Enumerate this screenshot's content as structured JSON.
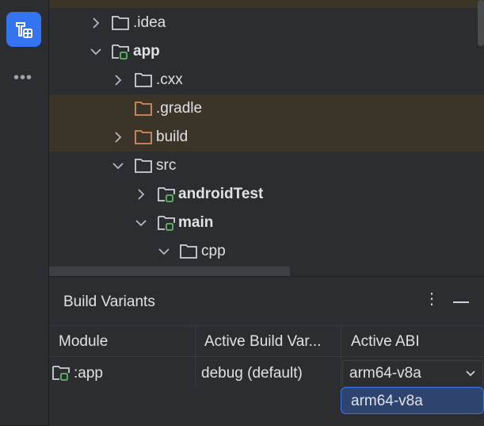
{
  "tree": {
    "items": [
      {
        "label": ".idea",
        "arrow": "right",
        "type": "folder"
      },
      {
        "label": "app",
        "arrow": "down",
        "type": "module"
      },
      {
        "label": ".cxx",
        "arrow": "right",
        "type": "folder"
      },
      {
        "label": ".gradle",
        "arrow": "",
        "type": "folder-orange"
      },
      {
        "label": "build",
        "arrow": "right",
        "type": "folder-orange"
      },
      {
        "label": "src",
        "arrow": "down",
        "type": "folder"
      },
      {
        "label": "androidTest",
        "arrow": "right",
        "type": "module"
      },
      {
        "label": "main",
        "arrow": "down",
        "type": "module"
      },
      {
        "label": "cpp",
        "arrow": "down",
        "type": "folder"
      }
    ]
  },
  "panel": {
    "title": "Build Variants",
    "columns": [
      "Module",
      "Active Build Var...",
      "Active ABI"
    ],
    "rows": [
      {
        "module": ":app",
        "variant": "debug (default)",
        "abi": "arm64-v8a"
      }
    ],
    "dropdown_options": [
      "arm64-v8a"
    ]
  },
  "colors": {
    "accent": "#3574f0",
    "highlight": "#3b3428",
    "module_green": "#5fb865",
    "folder_orange": "#d48c60"
  },
  "icons": {
    "tool": "build-variants-icon",
    "more": "more-horizontal-icon"
  }
}
